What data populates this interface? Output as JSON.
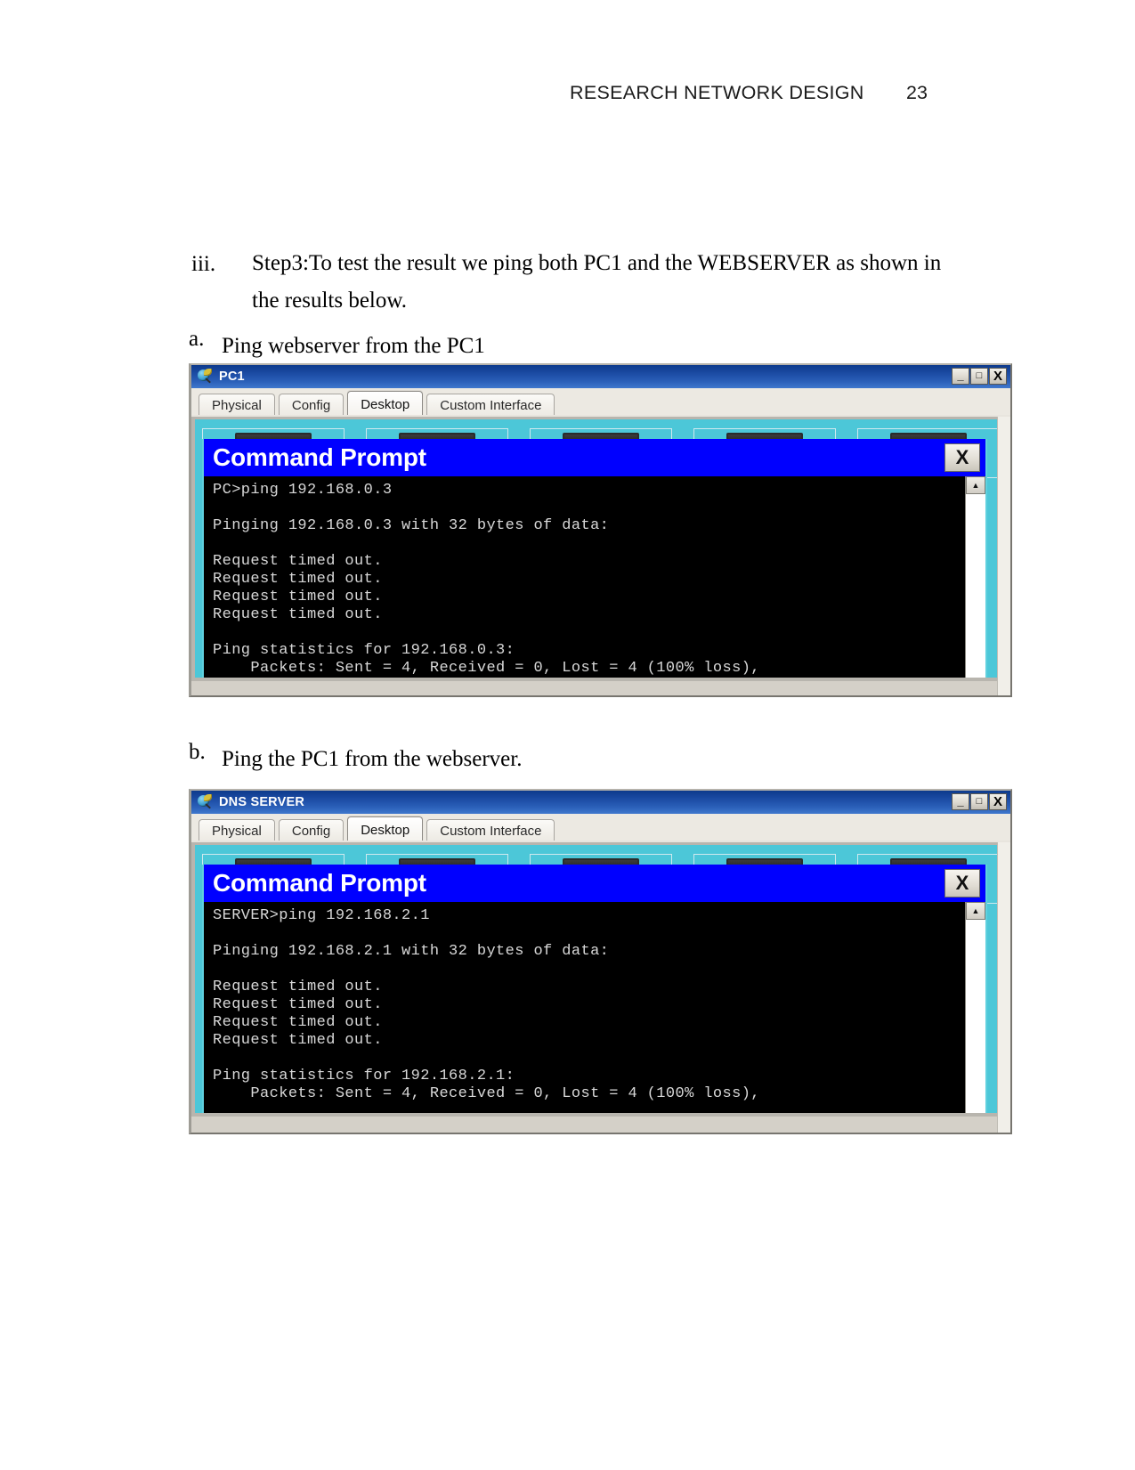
{
  "page": {
    "header_title": "RESEARCH NETWORK DESIGN",
    "page_number": "23"
  },
  "document": {
    "item_iii_marker": "iii.",
    "item_iii_text": "Step3:To test the result we ping both PC1 and the WEBSERVER as shown in the results below.",
    "item_a_marker": "a.",
    "item_a_text": "Ping webserver from the PC1",
    "item_b_marker": "b.",
    "item_b_text": "Ping the PC1 from the webserver."
  },
  "windows": [
    {
      "title": "PC1",
      "icon": "packet-tracer-device-icon",
      "title_buttons": {
        "minimize": "_",
        "maximize": "□",
        "close": "X"
      },
      "tabs": [
        {
          "label": "Physical",
          "active": false
        },
        {
          "label": "Config",
          "active": false
        },
        {
          "label": "Desktop",
          "active": true
        },
        {
          "label": "Custom Interface",
          "active": false
        }
      ],
      "command_prompt": {
        "title": "Command Prompt",
        "close_label": "X",
        "scroll_up_glyph": "▲",
        "output": "PC>ping 192.168.0.3\n\nPinging 192.168.0.3 with 32 bytes of data:\n\nRequest timed out.\nRequest timed out.\nRequest timed out.\nRequest timed out.\n\nPing statistics for 192.168.0.3:\n    Packets: Sent = 4, Received = 0, Lost = 4 (100% loss),"
      }
    },
    {
      "title": "DNS SERVER",
      "icon": "packet-tracer-device-icon",
      "title_buttons": {
        "minimize": "_",
        "maximize": "□",
        "close": "X"
      },
      "tabs": [
        {
          "label": "Physical",
          "active": false
        },
        {
          "label": "Config",
          "active": false
        },
        {
          "label": "Desktop",
          "active": true
        },
        {
          "label": "Custom Interface",
          "active": false
        }
      ],
      "command_prompt": {
        "title": "Command Prompt",
        "close_label": "X",
        "scroll_up_glyph": "▲",
        "output": "SERVER>ping 192.168.2.1\n\nPinging 192.168.2.1 with 32 bytes of data:\n\nRequest timed out.\nRequest timed out.\nRequest timed out.\nRequest timed out.\n\nPing statistics for 192.168.2.1:\n    Packets: Sent = 4, Received = 0, Lost = 4 (100% loss),"
      }
    }
  ],
  "colors": {
    "titlebar_blue": "#1b4ba3",
    "cmd_titlebar_blue": "#0000ff",
    "desktop_cyan": "#4cc7d8",
    "window_chrome": "#d4d0c8"
  }
}
